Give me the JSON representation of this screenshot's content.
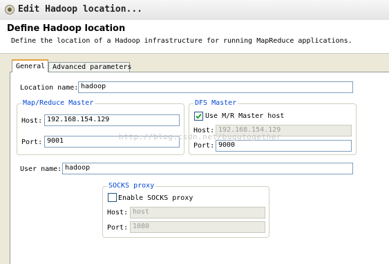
{
  "window": {
    "title": "Edit Hadoop location..."
  },
  "header": {
    "title": "Define Hadoop location",
    "description": "Define the location of a Hadoop infrastructure for running MapReduce applications."
  },
  "tabs": [
    {
      "label": "General",
      "active": true
    },
    {
      "label": "Advanced parameters",
      "active": false
    }
  ],
  "general": {
    "location_name_label": "Location name:",
    "location_name_value": "hadoop",
    "mapreduce_master": {
      "title": "Map/Reduce Master",
      "host_label": "Host:",
      "host_value": "192.168.154.129",
      "port_label": "Port:",
      "port_value": "9001"
    },
    "dfs_master": {
      "title": "DFS Master",
      "use_mr_host_label": "Use M/R Master host",
      "use_mr_host_checked": true,
      "host_label": "Host:",
      "host_value": "192.168.154.129",
      "port_label": "Port:",
      "port_value": "9000"
    },
    "user_name_label": "User name:",
    "user_name_value": "hadoop",
    "socks_proxy": {
      "title": "SOCKS proxy",
      "enable_label": "Enable SOCKS proxy",
      "enable_checked": false,
      "host_label": "Host:",
      "host_value": "host",
      "port_label": "Port:",
      "port_value": "1080"
    }
  },
  "watermark": "http://blog.csdn.net/bugutogether",
  "icons": {
    "title": "gear-icon",
    "checkbox_check": "check-icon"
  }
}
